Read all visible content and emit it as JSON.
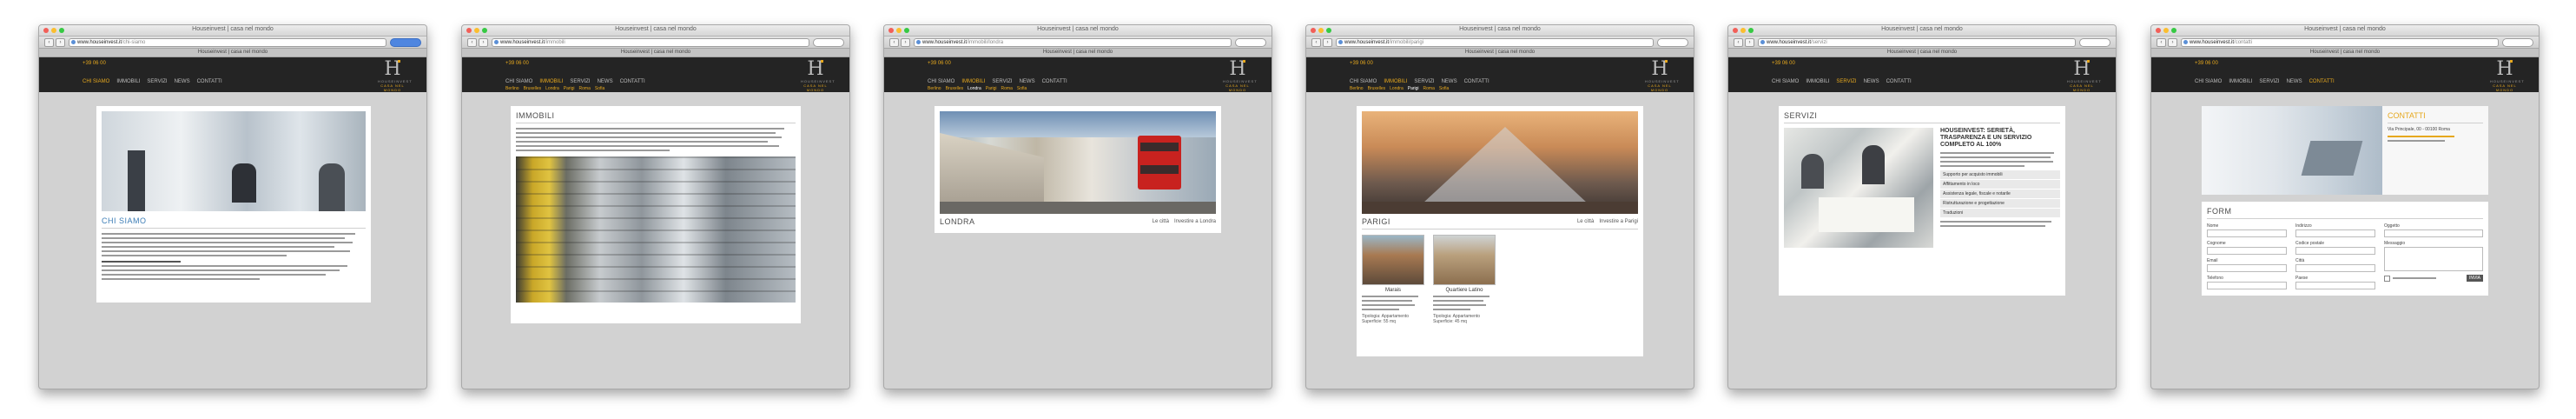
{
  "browser": {
    "title": "Houseinvest | casa nel mondo",
    "url_host": "www.houseinvest.it",
    "urls": [
      "/chi-siamo",
      "/immobili",
      "/immobili/londra",
      "/immobili/parigi",
      "/servizi",
      "/contatti"
    ]
  },
  "site": {
    "phone": "+39 06 00",
    "menu": [
      "Chi siamo",
      "Immobili",
      "Servizi",
      "News",
      "Contatti"
    ],
    "logo_letter": "H",
    "logo_line1": "HOUSEINVEST",
    "logo_line2": "CASA NEL MONDO",
    "cities": [
      "Berlino",
      "Bruxelles",
      "Londra",
      "Parigi",
      "Roma",
      "Sofia"
    ]
  },
  "pages": {
    "chisiamo": {
      "title": "Chi siamo"
    },
    "immobili": {
      "title": "Immobili"
    },
    "londra": {
      "title": "Londra",
      "links": [
        "Le città",
        "Investire a Londra"
      ]
    },
    "parigi": {
      "title": "Parigi",
      "links": [
        "Le città",
        "Investire a Parigi"
      ],
      "cards": [
        {
          "name": "Marais",
          "typology": "Tipologia: Appartamento",
          "surface": "Superficie: 55 mq"
        },
        {
          "name": "Quartiere Latino",
          "typology": "Tipologia: Appartamento",
          "surface": "Superficie: 45 mq"
        }
      ]
    },
    "servizi": {
      "title": "Servizi",
      "headline": "HOUSEINVEST: SERIETÀ, TRASPARENZA E UN SERVIZIO COMPLETO AL 100%",
      "services": [
        "Supporto per acquisto immobili",
        "Affittamento in loco",
        "Assistenza legale, fiscale e notarile",
        "Ristrutturazione e progettazione",
        "Traduzioni"
      ]
    },
    "contatti": {
      "title": "Contatti",
      "address": "Via Principale, 00 - 00100 Roma",
      "form_title": "Form",
      "fields_left": [
        "Nome",
        "Cognome",
        "Email",
        "Telefono"
      ],
      "fields_right": [
        "Indirizzo",
        "Codice postale",
        "Città",
        "Paese"
      ],
      "fields_extra": [
        "Oggetto",
        "Messaggio"
      ],
      "send_label": "INVIA"
    }
  },
  "colors": {
    "accent": "#e6a81e",
    "header_bg": "#242424",
    "page_bg": "#d2d2d2"
  }
}
